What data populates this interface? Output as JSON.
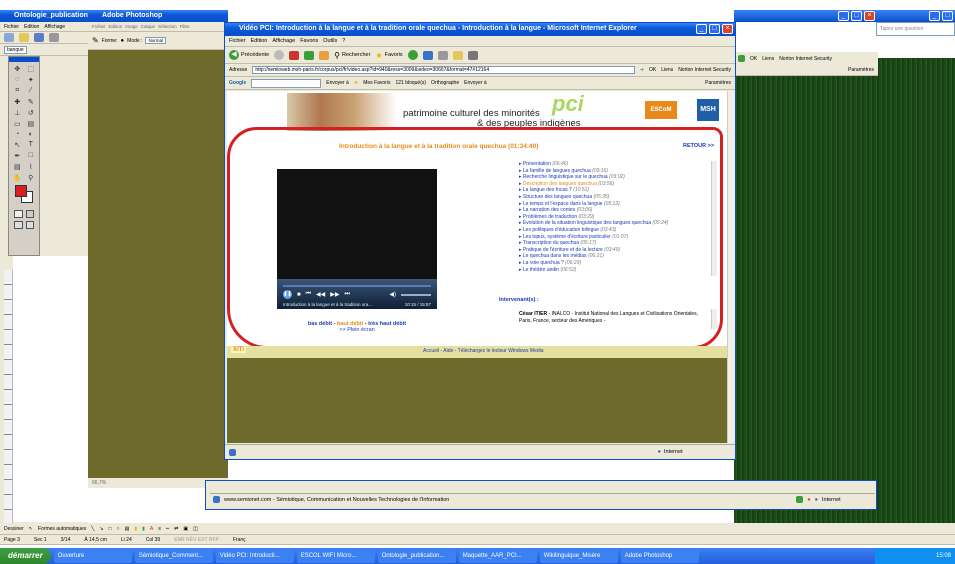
{
  "taskbar": {
    "start": "démarrer",
    "items": [
      "Ouverture",
      "Sémiotique_Comment...",
      "Vidéo PCI: Introducti...",
      "ESCOL WIFI Micro...",
      "Ontologie_publication...",
      "Maquette_AAR_PCI...",
      "Wikilinguique_Misère",
      "Adobe Photoshop"
    ],
    "clock": "15:08"
  },
  "word": {
    "title": "Ontologie_publication",
    "menu": [
      "Fichier",
      "Edition",
      "Affichage"
    ],
    "font_combo": "banque",
    "draw_label": "Dessiner",
    "autoshapes": "Formes automatiques",
    "status": {
      "page": "Page 3",
      "sec": "Sec 1",
      "pages": "3/14",
      "at": "À 14,5 cm",
      "li": "Li 24",
      "col": "Col 39",
      "modes": "ENR  RÉV  EXT  RFP",
      "lang": "Franç"
    }
  },
  "photoshop": {
    "title": "Adobe Photoshop",
    "menu": [
      "Fichier",
      "Edition",
      "Image",
      "Calque",
      "Sélection",
      "Filtre"
    ],
    "options": {
      "forme_label": "Forme:",
      "mode_label": "Mode :",
      "mode_value": "Normal"
    },
    "zoom": "66,7%"
  },
  "ie_back": {
    "search_placeholder": "Tapez une question",
    "links": "Liens",
    "norton": "Norton Internet Security",
    "params": "Paramètres",
    "status_url": "www.semionet.com - Sémiotique, Communication et Nouvelles Technologies de l'Information",
    "internet": "Internet"
  },
  "ie": {
    "title": "Vidéo PCI: Introduction à la langue et à la tradition orale quechua - Introduction à la langue - Microsoft Internet Explorer",
    "menu": [
      "Fichier",
      "Edition",
      "Affichage",
      "Favoris",
      "Outils",
      "?"
    ],
    "back": "Précédente",
    "search": "Rechercher",
    "favorites": "Favoris",
    "address_label": "Adresse",
    "address": "http://semioweb.msh-paris.fr/corpus/pci/fr/video.asp?id=940&ress=3009&video=30667&format=47#12164",
    "go": "OK",
    "links": "Liens",
    "norton": "Norton Internet Security",
    "params": "Paramètres",
    "google": "Google",
    "send": "Envoyer à",
    "myfav": "Mes Favoris",
    "blocked": "121 bloqué(s)",
    "spell": "Orthographe",
    "send2": "Envoyer à",
    "status": "Internet"
  },
  "page": {
    "heading1": "patrimoine culturel des minorités",
    "heading2": "& des peuples indigènes",
    "logo_esc": "ESCoM",
    "logo_msh": "MSH",
    "video_title": "Introduction à la langue et à la tradition orale quechua (01:34:40)",
    "retour": "RETOUR >>",
    "chapters": [
      {
        "label": "Présentation",
        "dur": "(06:46)",
        "active": false
      },
      {
        "label": "La famille de langues quechua",
        "dur": "(09:16)",
        "active": false
      },
      {
        "label": "Recherche linguistique sur le quechua",
        "dur": "(03:02)",
        "active": false
      },
      {
        "label": "Description des langues quechua",
        "dur": "(03:56)",
        "active": true
      },
      {
        "label": "La langue des Incas ?",
        "dur": "(10:51)",
        "active": false
      },
      {
        "label": "Structure des langues quechua",
        "dur": "(05:35)",
        "active": false
      },
      {
        "label": "Le temps et l'espace dans la langue",
        "dur": "(05:12)",
        "active": false
      },
      {
        "label": "La narration des contes",
        "dur": "(03:06)",
        "active": false
      },
      {
        "label": "Problèmes de traduction",
        "dur": "(03:29)",
        "active": false
      },
      {
        "label": "Évolution de la situation linguistique des langues quechua",
        "dur": "(05:24)",
        "active": false
      },
      {
        "label": "Les politiques d'éducation bilingue",
        "dur": "(03:43)",
        "active": false
      },
      {
        "label": "Les topus, système d'écriture particulier",
        "dur": "(01:07)",
        "active": false
      },
      {
        "label": "Transcription du quechua",
        "dur": "(05:17)",
        "active": false
      },
      {
        "label": "Pratique de l'écriture et de la lecture",
        "dur": "(03:49)",
        "active": false
      },
      {
        "label": "Le quechua dans les médias",
        "dur": "(06:21)",
        "active": false
      },
      {
        "label": "La voie quechua ?",
        "dur": "(06:29)",
        "active": false
      },
      {
        "label": "Le théâtre andin",
        "dur": "(06:52)",
        "active": false
      }
    ],
    "intervenants_label": "Intervenant(s) :",
    "intervenant_name": "César ITIER",
    "intervenant_desc": " - INALCO - Institut National des Langues et Civilisations Orientales, Paris, France, secteur des Amériques -",
    "player_caption": "Introduction à la langue et à la tradition ora...",
    "player_time": "10:15 / 15:57",
    "bitrate": {
      "low": "bas débit",
      "high": "haut débit",
      "very_high": "très haut débit",
      "fullscreen": ">> Plein écran"
    },
    "footer": "Accueil - Aide - Téléchargez le lecteur Windows Media",
    "xiti": "XiTi"
  },
  "colors": {
    "title_blue": "#0a58d8",
    "orange": "#e88a1a",
    "red_highlight": "#d42020",
    "link": "#1a3bb0",
    "photoshop_bg": "#6e6a2c",
    "grass": "#1c4a18"
  }
}
